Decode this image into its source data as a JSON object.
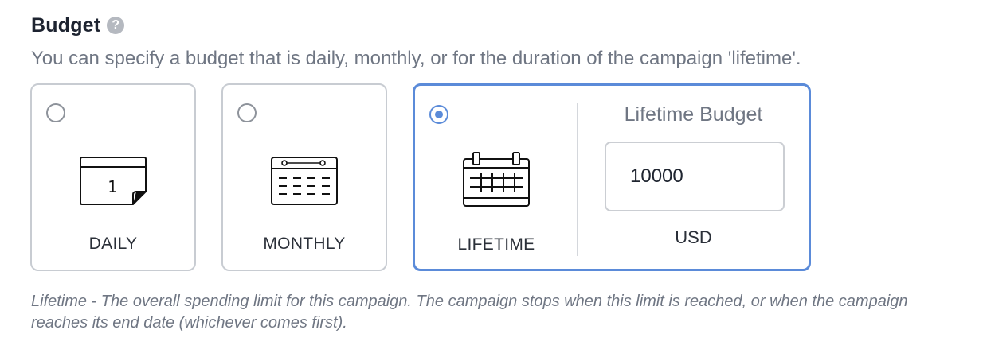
{
  "budget": {
    "title": "Budget",
    "help_icon": "question-circle-icon",
    "help_glyph": "?",
    "description": "You can specify a budget that is daily, monthly, or for the duration of the campaign 'lifetime'."
  },
  "options": {
    "daily": {
      "label": "DAILY",
      "icon": "calendar-day-icon",
      "calendar_day": "1",
      "selected": false
    },
    "monthly": {
      "label": "MONTHLY",
      "icon": "calendar-month-icon",
      "selected": false
    },
    "lifetime": {
      "label": "LIFETIME",
      "icon": "calendar-range-icon",
      "selected": true
    }
  },
  "lifetime_budget": {
    "heading": "Lifetime Budget",
    "value": "10000",
    "currency": "USD"
  },
  "footnote": "Lifetime - The overall spending limit for this campaign. The campaign stops when this limit is reached, or when the campaign reaches its end date (whichever comes first).",
  "colors": {
    "accent": "#5b8bd9",
    "border": "#c8ccd2",
    "muted_text": "#6f7683"
  }
}
